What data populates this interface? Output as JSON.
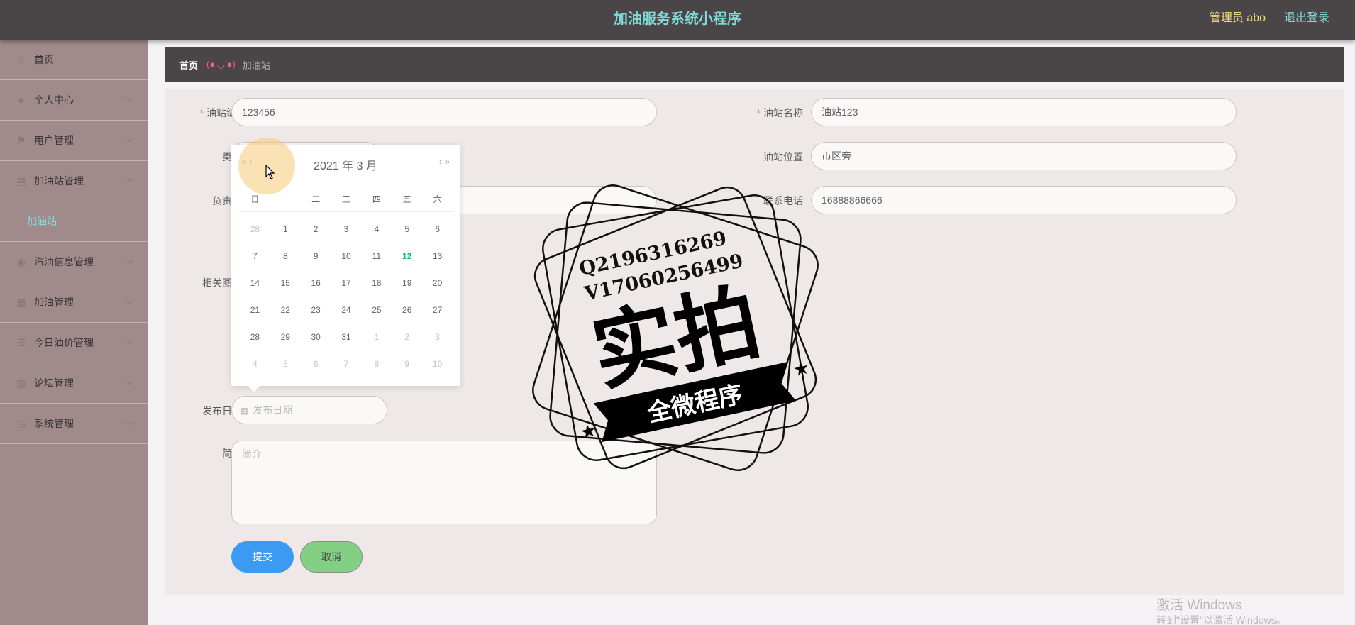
{
  "header": {
    "title": "加油服务系统小程序",
    "admin_label": "管理员 abo",
    "logout_label": "退出登录"
  },
  "sidebar": {
    "items": [
      {
        "label": "首页",
        "icon": "home-icon"
      },
      {
        "label": "个人中心",
        "icon": "user-icon"
      },
      {
        "label": "用户管理",
        "icon": "flag-icon"
      },
      {
        "label": "加油站管理",
        "icon": "doc-icon",
        "expanded": true
      },
      {
        "label": "汽油信息管理",
        "icon": "location-icon"
      },
      {
        "label": "加油管理",
        "icon": "grid-icon"
      },
      {
        "label": "今日油价管理",
        "icon": "list-icon"
      },
      {
        "label": "论坛管理",
        "icon": "doc-icon"
      },
      {
        "label": "系统管理",
        "icon": "clock-icon"
      }
    ],
    "sub_item": "加油站"
  },
  "breadcrumb": {
    "home": "首页",
    "separator": "(●'◡'●)",
    "current": "加油站"
  },
  "form": {
    "station_code_label": "油站编号",
    "station_code_value": "123456",
    "station_name_label": "油站名称",
    "station_name_value": "油站123",
    "type_label": "类型",
    "location_label": "油站位置",
    "location_value": "市区旁",
    "manager_label": "负责人",
    "phone_label": "联系电话",
    "phone_value": "16888866666",
    "image_label": "相关图片",
    "publish_date_label": "发布日期",
    "publish_date_placeholder": "发布日期",
    "intro_label": "简介",
    "intro_placeholder": "简介",
    "submit_label": "提交",
    "cancel_label": "取消"
  },
  "datepicker": {
    "year_month": "2021 年  3 月",
    "prev": "« ‹",
    "next": "› »",
    "weekdays": [
      "日",
      "一",
      "二",
      "三",
      "四",
      "五",
      "六"
    ],
    "weeks": [
      [
        "28",
        "1",
        "2",
        "3",
        "4",
        "5",
        "6"
      ],
      [
        "7",
        "8",
        "9",
        "10",
        "11",
        "12",
        "13"
      ],
      [
        "14",
        "15",
        "16",
        "17",
        "18",
        "19",
        "20"
      ],
      [
        "21",
        "22",
        "23",
        "24",
        "25",
        "26",
        "27"
      ],
      [
        "28",
        "29",
        "30",
        "31",
        "1",
        "2",
        "3"
      ],
      [
        "4",
        "5",
        "6",
        "7",
        "8",
        "9",
        "10"
      ]
    ],
    "today": "12"
  },
  "watermark": {
    "line1": "Q2196316269",
    "line2": "V17060256499",
    "big": "实拍",
    "ribbon": "全微程序"
  },
  "windows": {
    "activate_title": "激活 Windows",
    "activate_sub": "转到\"设置\"以激活 Windows。"
  }
}
